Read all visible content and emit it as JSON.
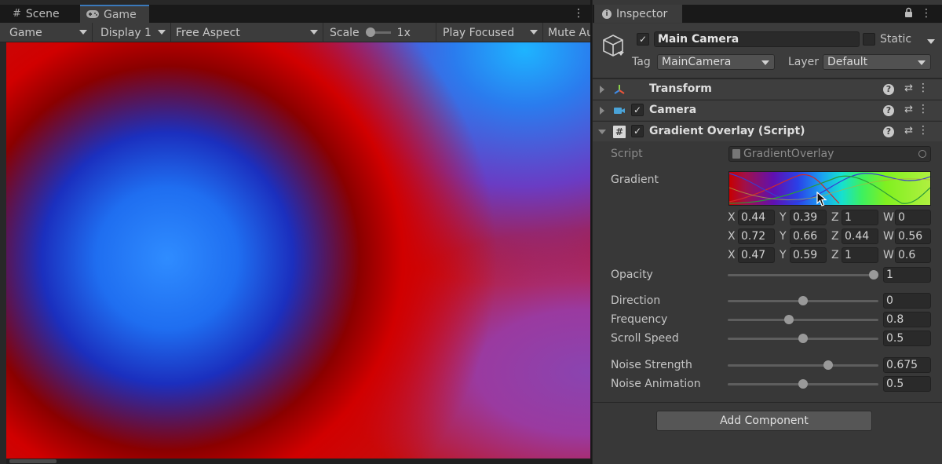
{
  "game_panel": {
    "tabs": [
      {
        "label": "Scene",
        "icon": "grid-icon"
      },
      {
        "label": "Game",
        "icon": "gamepad-icon"
      }
    ],
    "toolbar": {
      "mode": "Game",
      "display": "Display 1",
      "aspect": "Free Aspect",
      "scale_label": "Scale",
      "scale_value": "1x",
      "play_mode": "Play Focused",
      "mute": "Mute Au"
    }
  },
  "inspector": {
    "tab_label": "Inspector",
    "object": {
      "name": "Main Camera",
      "active": true,
      "static_label": "Static",
      "tag_label": "Tag",
      "tag_value": "MainCamera",
      "layer_label": "Layer",
      "layer_value": "Default"
    },
    "components": [
      {
        "title": "Transform",
        "icon": "transform-icon",
        "has_checkbox": false
      },
      {
        "title": "Camera",
        "icon": "camera-icon",
        "has_checkbox": true
      },
      {
        "title": "Gradient Overlay (Script)",
        "icon": "script-hash-icon",
        "has_checkbox": true
      }
    ],
    "script_label": "Script",
    "script_value": "GradientOverlay",
    "gradient_label": "Gradient",
    "vectors": [
      {
        "x": "0.44",
        "y": "0.39",
        "z": "1",
        "w": "0"
      },
      {
        "x": "0.72",
        "y": "0.66",
        "z": "0.44",
        "w": "0.56"
      },
      {
        "x": "0.47",
        "y": "0.59",
        "z": "1",
        "w": "0.6"
      }
    ],
    "axis_labels": {
      "x": "X",
      "y": "Y",
      "z": "Z",
      "w": "W"
    },
    "properties": [
      {
        "label": "Opacity",
        "value": "1",
        "fraction": 1.0
      },
      {
        "label": "Direction",
        "value": "0",
        "fraction": 0.5
      },
      {
        "label": "Frequency",
        "value": "0.8",
        "fraction": 0.4
      },
      {
        "label": "Scroll Speed",
        "value": "0.5",
        "fraction": 0.5
      },
      {
        "label": "Noise Strength",
        "value": "0.675",
        "fraction": 0.675
      },
      {
        "label": "Noise Animation",
        "value": "0.5",
        "fraction": 0.5
      }
    ],
    "add_component_label": "Add Component"
  }
}
